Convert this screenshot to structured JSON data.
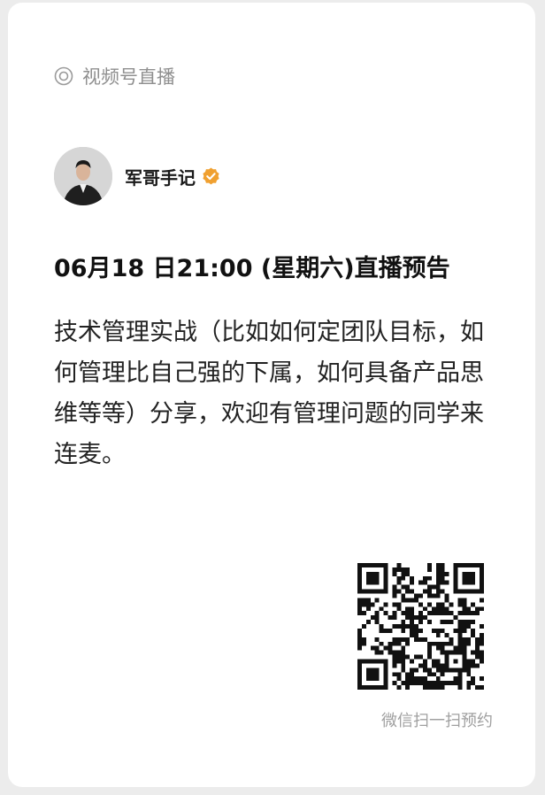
{
  "channel": {
    "icon": "live-ring-icon",
    "label": "视频号直播"
  },
  "author": {
    "name": "军哥手记",
    "verified_icon": "verified-badge-icon",
    "verified_color": "#f0a030"
  },
  "headline": "06月18 日21:00 (星期六)直播预告",
  "description": "技术管理实战（比如如何定团队目标，如何管理比自己强的下属，如何具备产品思维等等）分享，欢迎有管理问题的同学来连麦。",
  "qr": {
    "caption": "微信扫一扫预约"
  }
}
